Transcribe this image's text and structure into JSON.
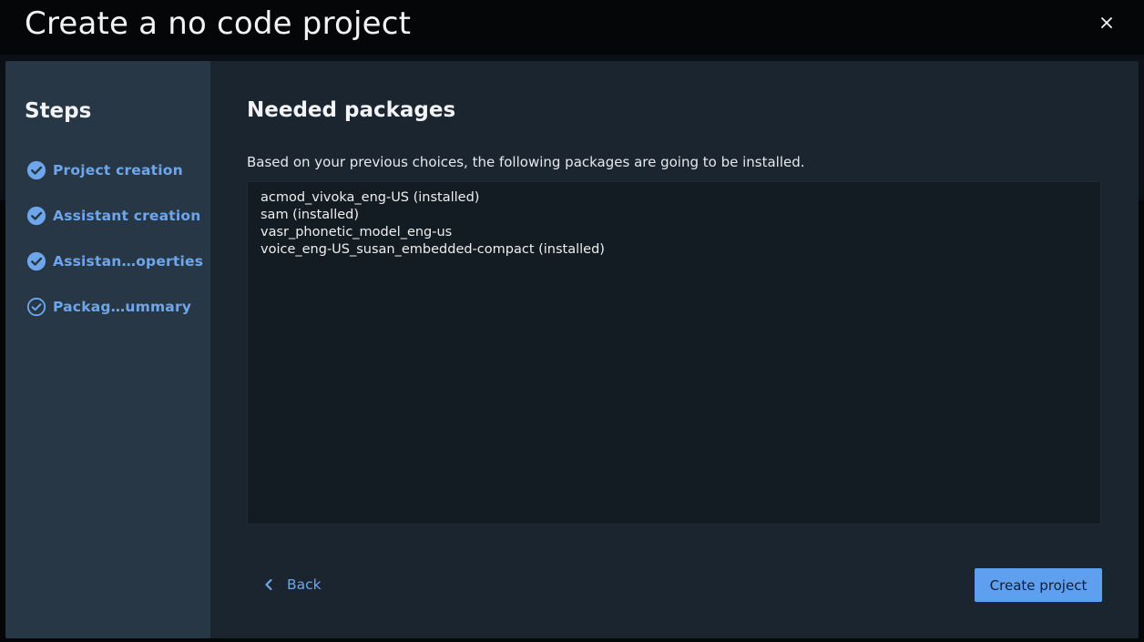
{
  "dialog": {
    "title": "Create a no code project",
    "close_icon": "close-icon"
  },
  "sidebar": {
    "title": "Steps",
    "items": [
      {
        "label": "Project creation",
        "icon": "check-circle-filled-icon",
        "status": "completed"
      },
      {
        "label": "Assistant creation",
        "icon": "check-circle-filled-icon",
        "status": "completed"
      },
      {
        "label": "Assistan…operties",
        "icon": "check-circle-filled-icon",
        "status": "completed"
      },
      {
        "label": "Packag…ummary",
        "icon": "check-circle-outline-icon",
        "status": "current"
      }
    ]
  },
  "main": {
    "title": "Needed packages",
    "description": "Based on your previous choices, the following packages are going to be installed.",
    "packages": [
      "acmod_vivoka_eng-US (installed)",
      "sam (installed)",
      "vasr_phonetic_model_eng-us",
      "voice_eng-US_susan_embedded-compact (installed)"
    ]
  },
  "footer": {
    "back_label": "Back",
    "back_icon": "chevron-left-icon",
    "create_label": "Create project"
  },
  "colors": {
    "accent": "#6ea6ec",
    "primary_button": "#5f9ff0",
    "sidebar_bg": "#283745",
    "content_bg": "#1b2530",
    "textarea_bg": "#141c23"
  }
}
